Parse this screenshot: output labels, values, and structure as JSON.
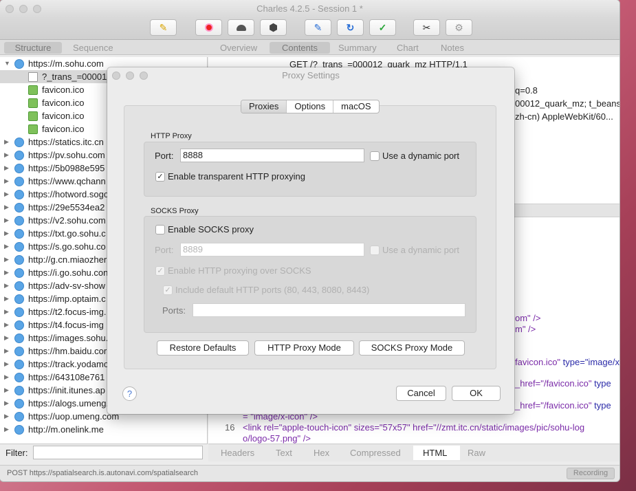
{
  "window": {
    "title": "Charles 4.2.5 - Session 1 *"
  },
  "toolbar": {
    "buttons": [
      {
        "name": "broom-icon",
        "glyph": "🧹"
      },
      {
        "name": "record-icon",
        "glyph": "⏺"
      },
      {
        "name": "throttle-turtle-icon",
        "glyph": "🐢"
      },
      {
        "name": "breakpoints-hexagon-icon",
        "glyph": "⬢"
      },
      {
        "name": "compose-pen-icon",
        "glyph": "✎"
      },
      {
        "name": "repeat-icon",
        "glyph": "↻"
      },
      {
        "name": "validate-check-icon",
        "glyph": "✓"
      },
      {
        "name": "tools-icon",
        "glyph": "✂"
      },
      {
        "name": "settings-gear-icon",
        "glyph": "⚙"
      }
    ]
  },
  "left_tabs": [
    "Structure",
    "Sequence"
  ],
  "right_tabs": [
    "Overview",
    "Contents",
    "Summary",
    "Chart",
    "Notes"
  ],
  "tree": [
    {
      "label": "https://m.sohu.com",
      "arrow": "▼",
      "icon": "bolt"
    },
    {
      "label": "?_trans_=000012",
      "arrow": "",
      "icon": "doc",
      "indent": true,
      "selected": true
    },
    {
      "label": "favicon.ico",
      "arrow": "",
      "icon": "img",
      "indent": true
    },
    {
      "label": "favicon.ico",
      "arrow": "",
      "icon": "img",
      "indent": true
    },
    {
      "label": "favicon.ico",
      "arrow": "",
      "icon": "img",
      "indent": true
    },
    {
      "label": "favicon.ico",
      "arrow": "",
      "icon": "img",
      "indent": true
    },
    {
      "label": "https://statics.itc.cn",
      "arrow": "▶",
      "icon": "globe"
    },
    {
      "label": "https://pv.sohu.com",
      "arrow": "▶",
      "icon": "globe"
    },
    {
      "label": "https://5b0988e595",
      "arrow": "▶",
      "icon": "globe"
    },
    {
      "label": "https://www.qchann",
      "arrow": "▶",
      "icon": "globe"
    },
    {
      "label": "https://hotword.sogo",
      "arrow": "▶",
      "icon": "globe"
    },
    {
      "label": "https://29e5534ea2",
      "arrow": "▶",
      "icon": "globe"
    },
    {
      "label": "https://v2.sohu.com",
      "arrow": "▶",
      "icon": "globe"
    },
    {
      "label": "https://txt.go.sohu.c",
      "arrow": "▶",
      "icon": "globe"
    },
    {
      "label": "https://s.go.sohu.co",
      "arrow": "▶",
      "icon": "globe"
    },
    {
      "label": "http://g.cn.miaozher",
      "arrow": "▶",
      "icon": "globe"
    },
    {
      "label": "https://i.go.sohu.con",
      "arrow": "▶",
      "icon": "globe"
    },
    {
      "label": "https://adv-sv-show",
      "arrow": "▶",
      "icon": "globe"
    },
    {
      "label": "https://imp.optaim.c",
      "arrow": "▶",
      "icon": "globe"
    },
    {
      "label": "https://t2.focus-img.",
      "arrow": "▶",
      "icon": "globe"
    },
    {
      "label": "https://t4.focus-img",
      "arrow": "▶",
      "icon": "globe"
    },
    {
      "label": "https://images.sohu.",
      "arrow": "▶",
      "icon": "globe"
    },
    {
      "label": "https://hm.baidu.cor",
      "arrow": "▶",
      "icon": "globe"
    },
    {
      "label": "https://track.yodamo",
      "arrow": "▶",
      "icon": "globe"
    },
    {
      "label": "https://643108e761",
      "arrow": "▶",
      "icon": "globe"
    },
    {
      "label": "https://init.itunes.ap",
      "arrow": "▶",
      "icon": "globe"
    },
    {
      "label": "https://alogs.umeng.",
      "arrow": "▶",
      "icon": "globe"
    },
    {
      "label": "https://uop.umeng.com",
      "arrow": "▶",
      "icon": "globe"
    },
    {
      "label": "http://m.onelink.me",
      "arrow": "▶",
      "icon": "globe"
    }
  ],
  "request_lines": {
    "line1": "GET /?_trans_=000012_quark_mz HTTP/1.1",
    "line2": "q=0.8",
    "line3": "00012_quark_mz; t_beans...",
    "line4": "zh-cn) AppleWebKit/60..."
  },
  "code": {
    "c1": "om\" />",
    "c2": "m\" />",
    "c3a": "favicon.ico\"",
    "c3b": " type=\"image/x",
    "c4a": "_href=\"/favicon.ico\"",
    "c4b": " type",
    "c5a": "_href=\"/favicon.ico\"",
    "c5b": " type",
    "c6": "= \"image/x-icon\" />",
    "line_no": "16",
    "c7": "<link rel=\"apple-touch-icon\" sizes=\"57x57\" href=\"//zmt.itc.cn/static/images/pic/sohu-log",
    "c8": "o/logo-57.png\" />"
  },
  "bottom_tabs": [
    "Headers",
    "Text",
    "Hex",
    "Compressed",
    "HTML",
    "Raw"
  ],
  "filter": {
    "label": "Filter:",
    "value": ""
  },
  "status": {
    "text": "POST https://spatialsearch.is.autonavi.com/spatialsearch",
    "recording": "Recording"
  },
  "dialog": {
    "title": "Proxy Settings",
    "tabs": [
      "Proxies",
      "Options",
      "macOS"
    ],
    "http": {
      "group_label": "HTTP Proxy",
      "port_label": "Port:",
      "port_value": "8888",
      "dynamic_label": "Use a dynamic port",
      "transparent_label": "Enable transparent HTTP proxying",
      "transparent_checked": "✓"
    },
    "socks": {
      "group_label": "SOCKS Proxy",
      "enable_label": "Enable SOCKS proxy",
      "port_label": "Port:",
      "port_placeholder": "8889",
      "dynamic_label": "Use a dynamic port",
      "http_over_label": "Enable HTTP proxying over SOCKS",
      "http_over_checked": "✓",
      "default_ports_label": "Include default HTTP ports (80, 443, 8080, 8443)",
      "default_ports_checked": "✓",
      "ports_label": "Ports:"
    },
    "buttons": {
      "restore": "Restore Defaults",
      "http_mode": "HTTP Proxy Mode",
      "socks_mode": "SOCKS Proxy Mode",
      "cancel": "Cancel",
      "ok": "OK",
      "help": "?"
    }
  }
}
